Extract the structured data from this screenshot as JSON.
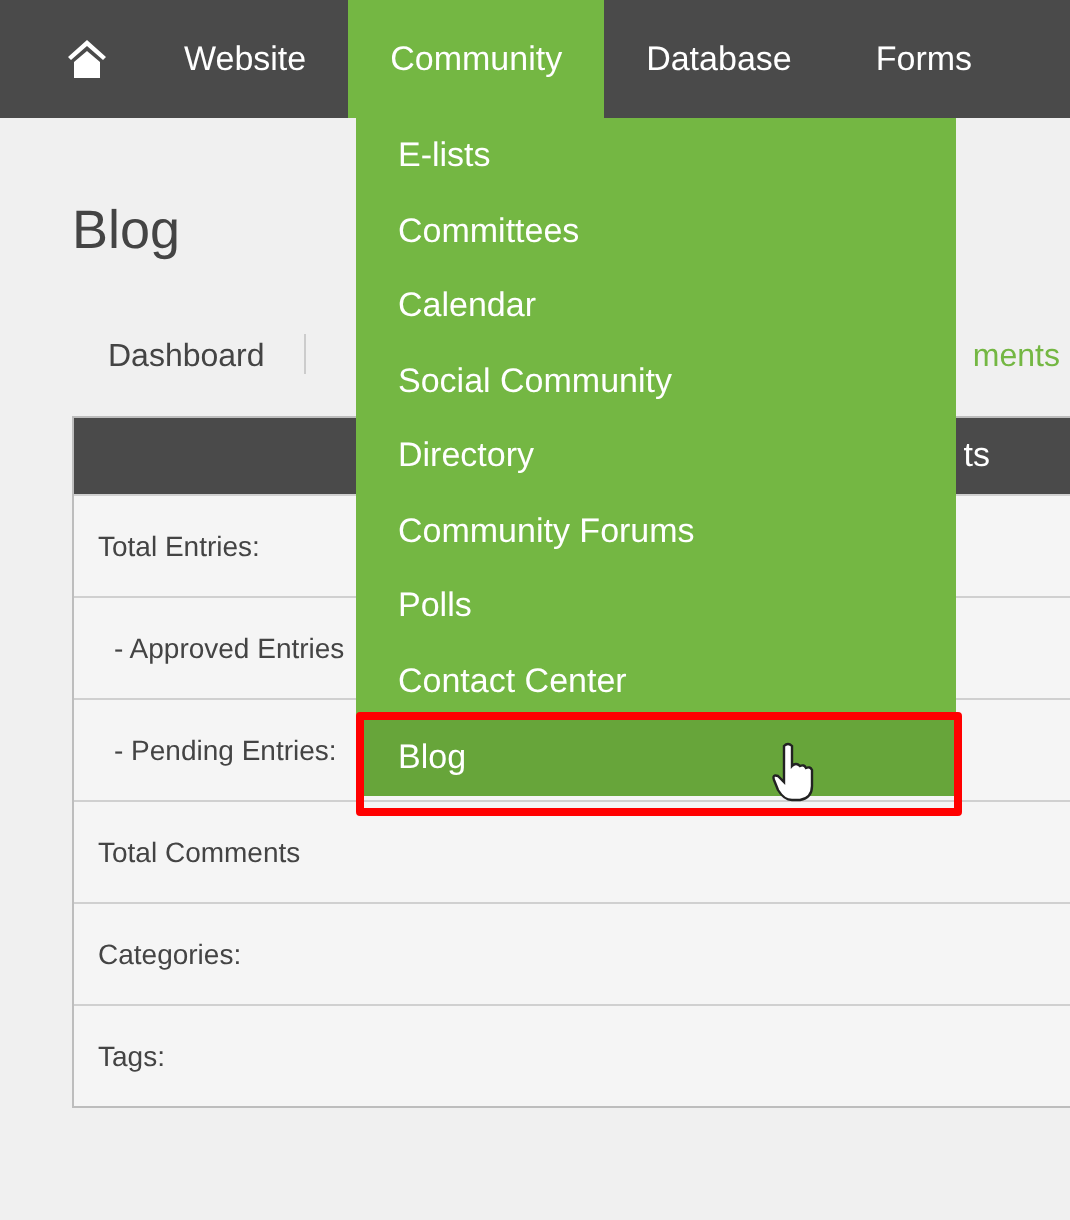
{
  "nav": [
    {
      "kind": "home",
      "selected": false
    },
    {
      "kind": "text",
      "label": "Website",
      "selected": false
    },
    {
      "kind": "text",
      "label": "Community",
      "selected": true
    },
    {
      "kind": "text",
      "label": "Database",
      "selected": false
    },
    {
      "kind": "text",
      "label": "Forms",
      "selected": false
    }
  ],
  "dropdown": {
    "items": [
      {
        "label": "E-lists",
        "selected": false
      },
      {
        "label": "Committees",
        "selected": false
      },
      {
        "label": "Calendar",
        "selected": false
      },
      {
        "label": "Social Community",
        "selected": false
      },
      {
        "label": "Directory",
        "selected": false
      },
      {
        "label": "Community Forums",
        "selected": false
      },
      {
        "label": "Polls",
        "selected": false
      },
      {
        "label": "Contact Center",
        "selected": false
      },
      {
        "label": "Blog",
        "selected": true
      }
    ]
  },
  "page_title": "Blog",
  "tabs": [
    {
      "label": "Dashboard",
      "selected": true
    },
    {
      "label": "ments",
      "selected": false
    }
  ],
  "table": {
    "header": "ts",
    "rows": [
      "Total Entries:",
      "- Approved Entries",
      "- Pending Entries:",
      "Total Comments",
      "Categories:",
      "Tags:"
    ]
  }
}
